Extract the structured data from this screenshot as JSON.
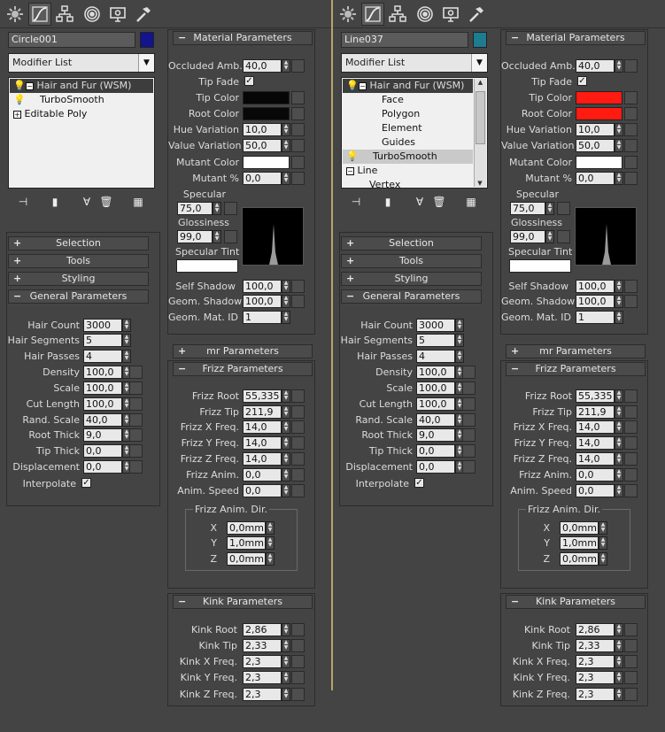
{
  "tabs": [
    {
      "icon": "sun-icon"
    },
    {
      "icon": "curve-icon"
    },
    {
      "icon": "hierarchy-icon"
    },
    {
      "icon": "motion-icon"
    },
    {
      "icon": "display-icon"
    },
    {
      "icon": "hammer-icon"
    }
  ],
  "left": {
    "object_name": "Circle001",
    "object_color": "#14148c",
    "modifier_list": "Modifier List",
    "stack": [
      {
        "label": "Hair and Fur (WSM)",
        "kind": "bulb-box"
      },
      {
        "label": "TurboSmooth",
        "kind": "bulb"
      },
      {
        "label": "Editable Poly",
        "kind": "plus"
      }
    ],
    "occluded_amb": "40,0",
    "tip_color": "#060606",
    "root_color": "#080808",
    "specular": "75,0",
    "glossiness": "99,0"
  },
  "right": {
    "object_name": "Line037",
    "object_color": "#1d7c90",
    "modifier_list": "Modifier List",
    "stack": [
      {
        "label": "Hair and Fur (WSM)",
        "kind": "bulb-box"
      },
      {
        "label": "Face",
        "kind": "sub"
      },
      {
        "label": "Polygon",
        "kind": "sub"
      },
      {
        "label": "Element",
        "kind": "sub"
      },
      {
        "label": "Guides",
        "kind": "sub"
      },
      {
        "label": "TurboSmooth",
        "kind": "bulb"
      },
      {
        "label": "Line",
        "kind": "box"
      },
      {
        "label": "Vertex",
        "kind": "sub2"
      }
    ],
    "occluded_amb": "40,0",
    "tip_color": "#ff1a12",
    "root_color": "#ff1a12",
    "specular": "75,0",
    "glossiness": "99,0"
  },
  "material": {
    "title": "Material Parameters",
    "occluded_amb": "Occluded Amb.",
    "tip_fade": "Tip Fade",
    "tip_color": "Tip Color",
    "root_color": "Root Color",
    "hue_variation": "Hue Variation",
    "hue_value": "10,0",
    "value_variation": "Value Variation",
    "value_value": "50,0",
    "mutant_color": "Mutant Color",
    "mutant_pct": "Mutant %",
    "mutant_pct_value": "0,0",
    "specular": "Specular",
    "glossiness": "Glossiness",
    "specular_tint": "Specular Tint",
    "self_shadow": "Self Shadow",
    "self_shadow_value": "100,0",
    "geom_shadow": "Geom. Shadow",
    "geom_shadow_value": "100,0",
    "geom_mat_id": "Geom. Mat. ID",
    "geom_mat_id_value": "1"
  },
  "rollouts": {
    "selection": "Selection",
    "tools": "Tools",
    "styling": "Styling",
    "general": "General Parameters",
    "mr": "mr Parameters",
    "frizz": "Frizz Parameters",
    "kink": "Kink Parameters"
  },
  "general": [
    {
      "label": "Hair Count",
      "value": "3000"
    },
    {
      "label": "Hair Segments",
      "value": "5"
    },
    {
      "label": "Hair Passes",
      "value": "4"
    },
    {
      "label": "Density",
      "value": "100,0"
    },
    {
      "label": "Scale",
      "value": "100,0"
    },
    {
      "label": "Cut Length",
      "value": "100,0"
    },
    {
      "label": "Rand. Scale",
      "value": "40,0"
    },
    {
      "label": "Root Thick",
      "value": "9,0"
    },
    {
      "label": "Tip Thick",
      "value": "0,0"
    },
    {
      "label": "Displacement",
      "value": "0,0"
    }
  ],
  "interpolate": "Interpolate",
  "frizz": [
    {
      "label": "Frizz Root",
      "value": "55,335"
    },
    {
      "label": "Frizz Tip",
      "value": "211,9"
    },
    {
      "label": "Frizz X Freq.",
      "value": "14,0"
    },
    {
      "label": "Frizz Y Freq.",
      "value": "14,0"
    },
    {
      "label": "Frizz Z Freq.",
      "value": "14,0"
    },
    {
      "label": "Frizz Anim.",
      "value": "0,0"
    },
    {
      "label": "Anim. Speed",
      "value": "0,0"
    }
  ],
  "frizz_dir": {
    "title": "Frizz Anim. Dir.",
    "items": [
      {
        "label": "X",
        "value": "0,0mm"
      },
      {
        "label": "Y",
        "value": "1,0mm"
      },
      {
        "label": "Z",
        "value": "0,0mm"
      }
    ]
  },
  "kink": [
    {
      "label": "Kink Root",
      "value": "2,86"
    },
    {
      "label": "Kink Tip",
      "value": "2,33"
    },
    {
      "label": "Kink X Freq.",
      "value": "2,3"
    },
    {
      "label": "Kink Y Freq.",
      "value": "2,3"
    },
    {
      "label": "Kink Z Freq.",
      "value": "2,3"
    }
  ]
}
